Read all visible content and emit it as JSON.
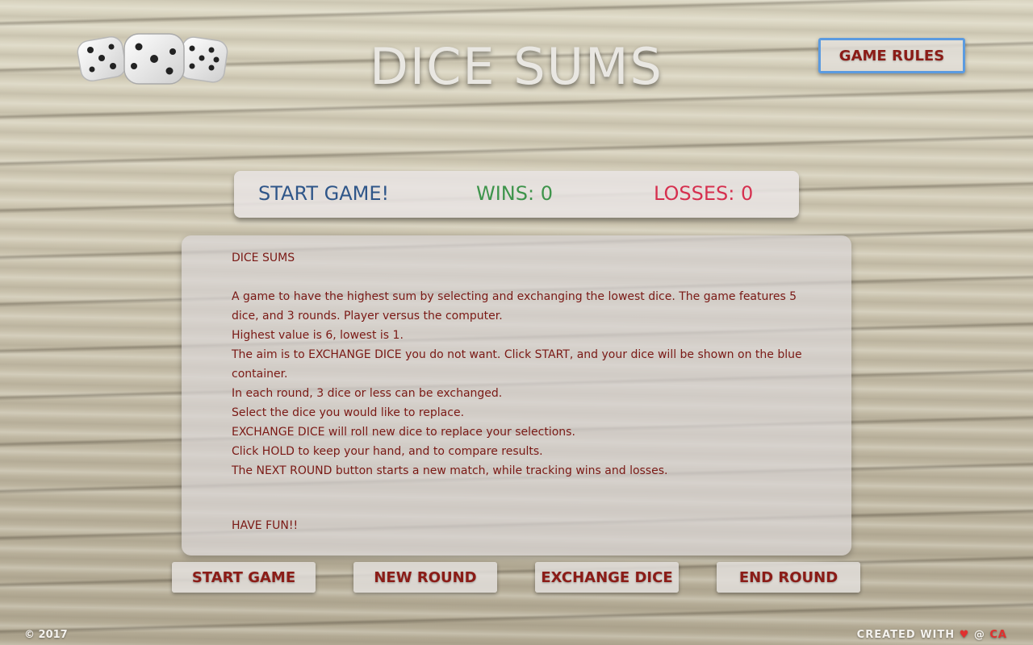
{
  "header": {
    "title": "DICE SUMS",
    "rules_button": "GAME RULES"
  },
  "score": {
    "status": "START GAME!",
    "wins": "WINS: 0",
    "losses": "LOSSES: 0"
  },
  "rules": {
    "heading": "DICE SUMS",
    "lines": [
      "A game to have the highest sum by selecting and exchanging the lowest dice. The game features 5 dice, and 3 rounds. Player versus the computer.",
      "Highest value is 6, lowest is 1.",
      "The aim is to EXCHANGE DICE you do not want. Click START, and your dice will be shown on the blue container.",
      "In each round, 3 dice or less can be exchanged.",
      "Select the dice you would like to replace.",
      "EXCHANGE DICE will roll new dice to replace your selections.",
      "Click HOLD to keep your hand, and to compare results.",
      "The NEXT ROUND button starts a new match, while tracking wins and losses."
    ],
    "closing": "HAVE FUN!!"
  },
  "buttons": {
    "start": "START GAME",
    "new_round": "NEW ROUND",
    "exchange": "EXCHANGE DICE",
    "end_round": "END ROUND"
  },
  "footer": {
    "copyright": "© 2017",
    "created_prefix": "CREATED WITH",
    "heart_icon": "♥",
    "at": "@",
    "author": "CA"
  },
  "colors": {
    "accent_red": "#8b1c17",
    "status_blue": "#2f5689",
    "wins_green": "#3e944b",
    "losses_red": "#d6304f",
    "rules_border": "#5b9be0"
  },
  "icons": {
    "logo": "dice-logo-icon",
    "heart": "heart-icon"
  }
}
